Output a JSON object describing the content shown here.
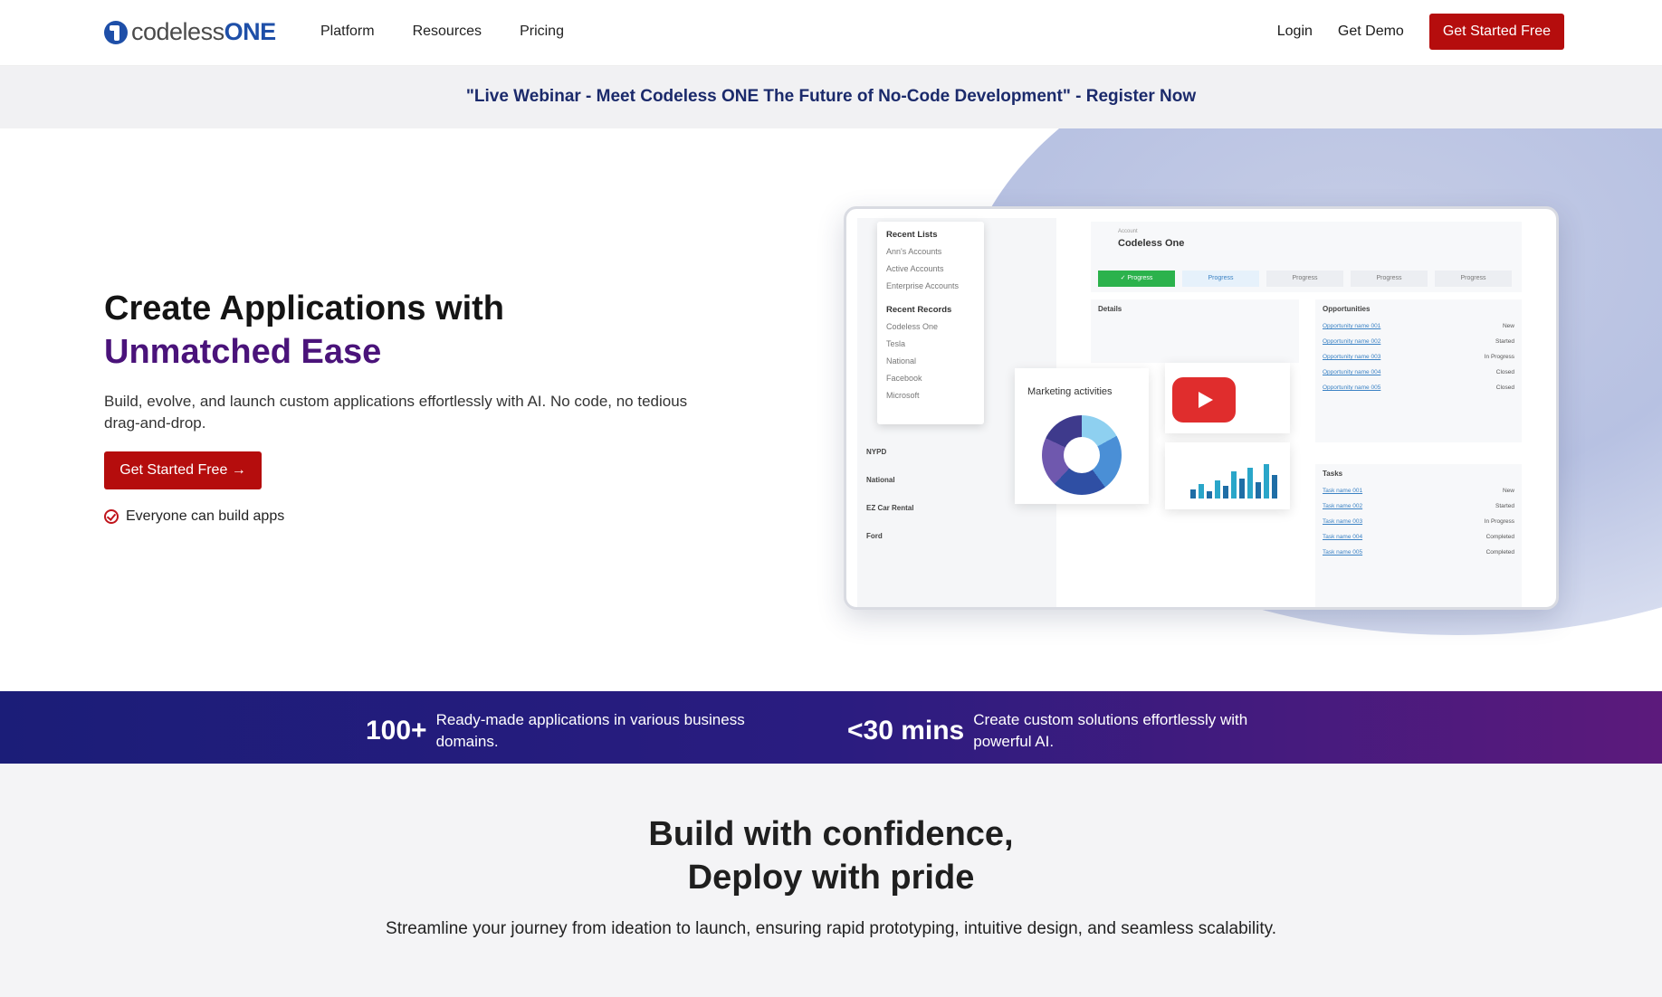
{
  "nav": {
    "logo_prefix": "codeless",
    "logo_suffix": "ONE",
    "links": [
      "Platform",
      "Resources",
      "Pricing"
    ],
    "login": "Login",
    "demo": "Get Demo",
    "cta": "Get Started Free"
  },
  "banner": {
    "text": "\"Live Webinar - Meet Codeless ONE The Future of No-Code Development\" - Register Now"
  },
  "hero": {
    "title_line1": "Create Applications with",
    "title_line2": "Unmatched Ease",
    "subtitle": "Build, evolve, and launch custom applications effortlessly with AI. No code, no tedious drag-and-drop.",
    "cta": "Get Started Free →",
    "check_text": "Everyone can build apps"
  },
  "mockup": {
    "recent_lists_head": "Recent Lists",
    "recent_lists": [
      "Ann's Accounts",
      "Active Accounts",
      "Enterprise Accounts"
    ],
    "recent_records_head": "Recent Records",
    "recent_records": [
      "Codeless One",
      "Tesla",
      "National",
      "Facebook",
      "Microsoft"
    ],
    "left_rows": [
      "NYPD",
      "National",
      "EZ Car Rental",
      "Ford"
    ],
    "account_small": "Account",
    "account_title": "Codeless One",
    "steps": [
      "✓ Progress",
      "Progress",
      "Progress",
      "Progress",
      "Progress"
    ],
    "details_head": "Details",
    "opportunities_head": "Opportunities",
    "opportunities": [
      {
        "name": "Opportunity name 001",
        "status": "New"
      },
      {
        "name": "Opportunity name 002",
        "status": "Started"
      },
      {
        "name": "Opportunity name 003",
        "status": "In Progress"
      },
      {
        "name": "Opportunity name 004",
        "status": "Closed"
      },
      {
        "name": "Opportunity name 005",
        "status": "Closed"
      }
    ],
    "tasks_head": "Tasks",
    "tasks": [
      {
        "name": "Task name 001",
        "status": "New"
      },
      {
        "name": "Task name 002",
        "status": "Started"
      },
      {
        "name": "Task name 003",
        "status": "In Progress"
      },
      {
        "name": "Task name 004",
        "status": "Completed"
      },
      {
        "name": "Task name 005",
        "status": "Completed"
      }
    ],
    "marketing_title": "Marketing activities"
  },
  "stats": [
    {
      "num": "100+",
      "text": "Ready-made applications in various business domains."
    },
    {
      "num": "<30 mins",
      "text": "Create custom solutions effortlessly with powerful AI."
    }
  ],
  "section": {
    "title_line1": "Build with confidence,",
    "title_line2": "Deploy with pride",
    "subtitle": "Streamline your journey from ideation to launch, ensuring rapid prototyping, intuitive design, and seamless scalability."
  }
}
